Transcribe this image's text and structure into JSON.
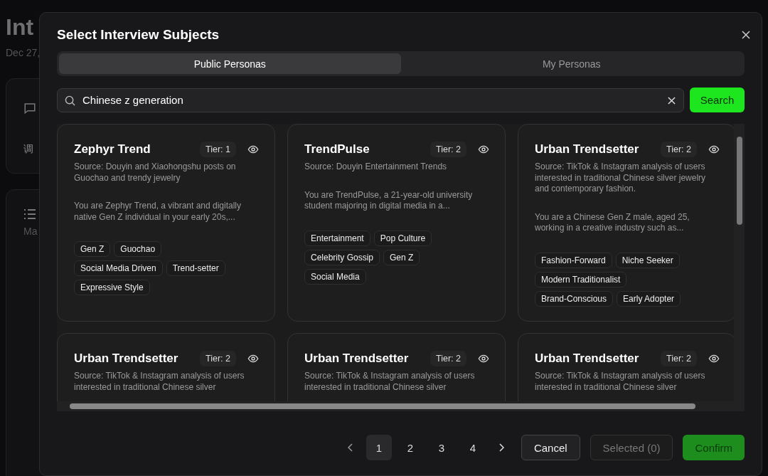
{
  "background": {
    "title": "Int",
    "date": "Dec 27,",
    "card_text": "调",
    "list_label": "Ma"
  },
  "modal": {
    "title": "Select Interview Subjects",
    "tabs": [
      {
        "label": "Public Personas",
        "selected": true
      },
      {
        "label": "My Personas",
        "selected": false
      }
    ],
    "search": {
      "value": "Chinese z generation",
      "button": "Search"
    },
    "personas": [
      {
        "name": "Zephyr Trend",
        "tier": "Tier: 1",
        "source": "Source: Douyin and Xiaohongshu posts on Guochao and trendy jewelry",
        "summary": "You are Zephyr Trend, a vibrant and digitally native Gen Z individual in your early 20s,...",
        "tags": [
          "Gen Z",
          "Guochao",
          "Social Media Driven",
          "Trend-setter",
          "Expressive Style"
        ]
      },
      {
        "name": "TrendPulse",
        "tier": "Tier: 2",
        "source": "Source: Douyin Entertainment Trends",
        "summary": "You are TrendPulse, a 21-year-old university student majoring in digital media in a...",
        "tags": [
          "Entertainment",
          "Pop Culture",
          "Celebrity Gossip",
          "Gen Z",
          "Social Media"
        ]
      },
      {
        "name": "Urban Trendsetter",
        "tier": "Tier: 2",
        "source": "Source: TikTok & Instagram analysis of users interested in traditional Chinese silver jewelry and contemporary fashion.",
        "summary": "You are a Chinese Gen Z male, aged 25, working in a creative industry such as...",
        "tags": [
          "Fashion-Forward",
          "Niche Seeker",
          "Modern Traditionalist",
          "Brand-Conscious",
          "Early Adopter"
        ]
      },
      {
        "name": "Urban Trendsetter",
        "tier": "Tier: 2",
        "source": "Source: TikTok & Instagram analysis of users interested in traditional Chinese silver"
      },
      {
        "name": "Urban Trendsetter",
        "tier": "Tier: 2",
        "source": "Source: TikTok & Instagram analysis of users interested in traditional Chinese silver"
      },
      {
        "name": "Urban Trendsetter",
        "tier": "Tier: 2",
        "source": "Source: TikTok & Instagram analysis of users interested in traditional Chinese silver"
      }
    ],
    "pagination": [
      {
        "label": "1",
        "selected": true
      },
      {
        "label": "2",
        "selected": false
      },
      {
        "label": "3",
        "selected": false
      },
      {
        "label": "4",
        "selected": false
      }
    ],
    "cancel": "Cancel",
    "selected_button": {
      "label": "Selected (0)",
      "disabled": true
    },
    "confirm": {
      "label": "Confirm",
      "disabled": true
    }
  }
}
